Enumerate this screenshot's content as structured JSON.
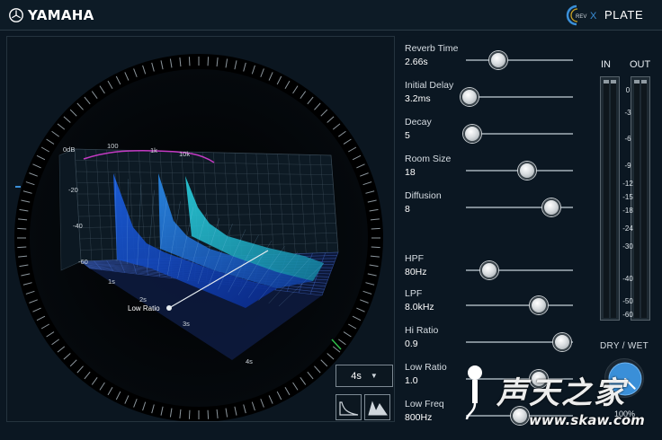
{
  "header": {
    "brand": "YAMAHA",
    "rev_logo_text": "REV",
    "rev_logo_suffix": "X",
    "preset": "PLATE"
  },
  "display": {
    "freq_labels": [
      "0dB",
      "100",
      "1k",
      "10k"
    ],
    "db_labels": [
      "-20",
      "-40",
      "-60"
    ],
    "time_labels": [
      "1s",
      "2s",
      "3s",
      "4s"
    ],
    "handle_label": "Low Ratio",
    "time_range": "4s",
    "view_buttons": [
      "decay-curve-icon",
      "decay-3d-icon"
    ]
  },
  "params": [
    {
      "label": "Reverb Time",
      "value": "2.66s",
      "pos": 0.3
    },
    {
      "label": "Initial Delay",
      "value": "3.2ms",
      "pos": 0.03
    },
    {
      "label": "Decay",
      "value": "5",
      "pos": 0.06
    },
    {
      "label": "Room Size",
      "value": "18",
      "pos": 0.57
    },
    {
      "label": "Diffusion",
      "value": "8",
      "pos": 0.8
    },
    {
      "label": "HPF",
      "value": "80Hz",
      "pos": 0.22
    },
    {
      "label": "LPF",
      "value": "8.0kHz",
      "pos": 0.68
    },
    {
      "label": "Hi Ratio",
      "value": "0.9",
      "pos": 0.9
    },
    {
      "label": "Low Ratio",
      "value": "1.0",
      "pos": 0.68
    },
    {
      "label": "Low Freq",
      "value": "800Hz",
      "pos": 0.5
    }
  ],
  "meters": {
    "in_label": "IN",
    "out_label": "OUT",
    "scale": [
      "0",
      "-3",
      "-6",
      "-9",
      "-12",
      "-15",
      "-18",
      "-24",
      "-30",
      "-40",
      "-50",
      "-60"
    ]
  },
  "drywet": {
    "label": "DRY / WET",
    "value": "100%",
    "level": 1.0
  },
  "watermark": {
    "text": "声天之家",
    "url": "www.skaw.com"
  },
  "colors": {
    "accent": "#3a8fd8",
    "background": "#0b1722",
    "knob": "#d9dde0"
  }
}
